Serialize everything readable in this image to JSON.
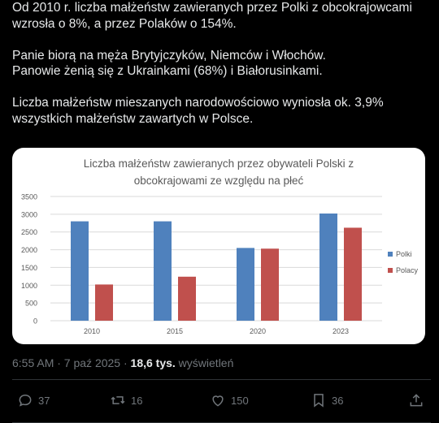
{
  "tweet": {
    "text": "Od 2010 r. liczba małżeństw zawieranych przez Polki z obcokrajowcami wzrosła o 8%, a przez Polaków o 154%.\n\nPanie biorą na męża Brytyjczyków, Niemców i Włochów.\nPanowie żenią się z Ukrainkami (68%) i Białorusinkami.\n\nLiczba małżeństw mieszanych narodowościowo wyniosła ok. 3,9% wszystkich małżeństw zawartych w Polsce."
  },
  "meta": {
    "time": "6:55 AM · 7 paź 2025 · ",
    "views_count": "18,6 tys.",
    "views_label": " wyświetleń"
  },
  "actions": {
    "replies": "37",
    "reposts": "16",
    "likes": "150",
    "bookmarks": "36"
  },
  "icons": [
    "reply-icon",
    "repost-icon",
    "like-icon",
    "bookmark-icon",
    "share-icon"
  ],
  "chart_data": {
    "type": "bar",
    "title": "Liczba małżeństw zawieranych przez obywateli Polski z obcokrajowami ze względu na płeć",
    "title_lines": [
      "Liczba małżeństw zawieranych przez obywateli Polski z",
      "obcokrajowami ze względu na płeć"
    ],
    "categories": [
      "2010",
      "2015",
      "2020",
      "2023"
    ],
    "series": [
      {
        "name": "Polki",
        "values": [
          2800,
          2800,
          2050,
          3020
        ],
        "color": "#4f81bd"
      },
      {
        "name": "Polacy",
        "values": [
          1020,
          1240,
          2030,
          2620
        ],
        "color": "#c0504d"
      }
    ],
    "ylim": [
      0,
      3500
    ],
    "yticks": [
      0,
      500,
      1000,
      1500,
      2000,
      2500,
      3000,
      3500
    ],
    "grid": true,
    "legend": "right"
  }
}
